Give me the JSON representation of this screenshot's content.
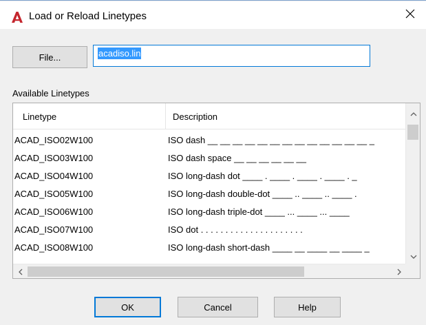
{
  "window": {
    "title": "Load or Reload Linetypes",
    "icon": "autocad-logo-icon",
    "close_icon": "close-icon"
  },
  "file": {
    "button_label": "File...",
    "value": "acadiso.lin"
  },
  "list": {
    "label": "Available Linetypes",
    "columns": [
      "Linetype",
      "Description"
    ],
    "rows": [
      {
        "name": "ACAD_ISO02W100",
        "desc": "ISO dash __ __ __ __ __ __ __ __ __ __ __ __ __ _"
      },
      {
        "name": "ACAD_ISO03W100",
        "desc": "ISO dash space __    __    __    __    __    __"
      },
      {
        "name": "ACAD_ISO04W100",
        "desc": "ISO long-dash dot ____ . ____ . ____ . ____ . _"
      },
      {
        "name": "ACAD_ISO05W100",
        "desc": "ISO long-dash double-dot ____ .. ____ .. ____ ."
      },
      {
        "name": "ACAD_ISO06W100",
        "desc": "ISO long-dash triple-dot ____ ... ____ ... ____"
      },
      {
        "name": "ACAD_ISO07W100",
        "desc": "ISO dot . . . . . . . . . . . . . . . . . . . . ."
      },
      {
        "name": "ACAD_ISO08W100",
        "desc": "ISO long-dash short-dash ____ __ ____ __ ____ _"
      }
    ]
  },
  "buttons": {
    "ok": "OK",
    "cancel": "Cancel",
    "help": "Help"
  },
  "colors": {
    "accent": "#0078d7",
    "selection": "#3399ff",
    "logo_red": "#c4262e"
  }
}
